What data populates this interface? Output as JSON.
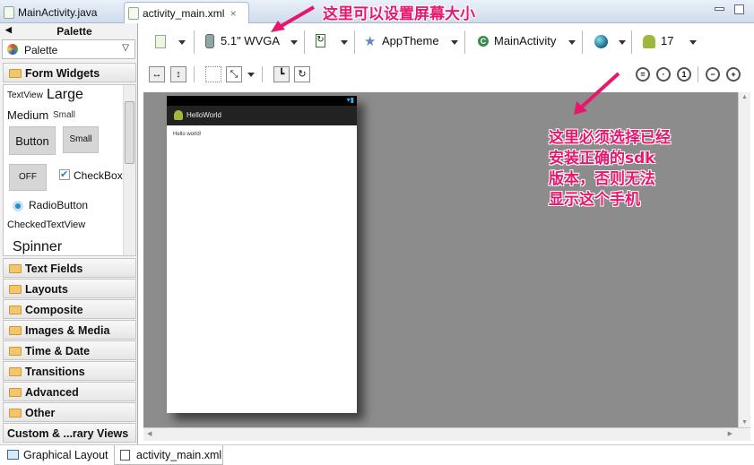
{
  "tabs": [
    {
      "label": "MainActivity.java"
    },
    {
      "label": "activity_main.xml",
      "close": "×"
    }
  ],
  "palette": {
    "title": "Palette",
    "selector": "Palette",
    "form_widgets": "Form Widgets",
    "widgets": {
      "textview": "TextView",
      "large": "Large",
      "medium": "Medium",
      "small": "Small",
      "button": "Button",
      "small_button": "Small",
      "toggle": "OFF",
      "checkbox": "CheckBox",
      "radio": "RadioButton",
      "checked": "CheckedTextView",
      "spinner": "Spinner"
    },
    "categories": [
      "Text Fields",
      "Layouts",
      "Composite",
      "Images & Media",
      "Time & Date",
      "Transitions",
      "Advanced",
      "Other",
      "Custom & ...rary Views"
    ]
  },
  "toolbar": {
    "device": "5.1\" WVGA",
    "theme": "AppTheme",
    "activity": "MainActivity",
    "api": "17"
  },
  "preview": {
    "app_title": "HelloWorld",
    "text": "Hello world!"
  },
  "bottom_tabs": [
    "Graphical Layout",
    "activity_main.xml"
  ],
  "annotations": {
    "top": "这里可以设置屏幕大小",
    "right": [
      "这里必须选择已经",
      "安装正确的sdk",
      "版本，否则无法",
      "显示这个手机"
    ],
    "color": "#e8176d"
  }
}
